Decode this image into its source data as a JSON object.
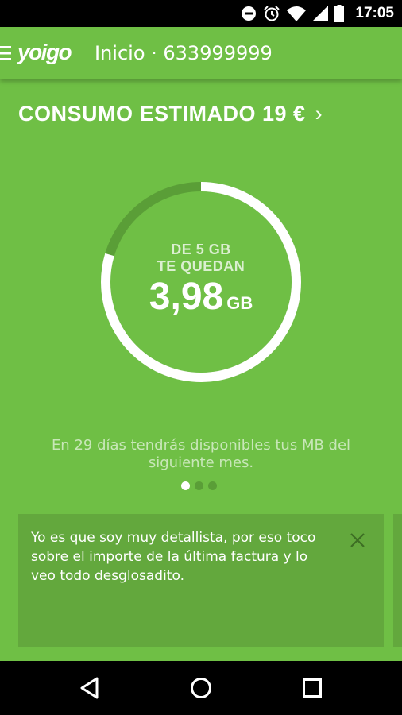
{
  "status_bar": {
    "time": "17:05",
    "icons": [
      "do-not-disturb-icon",
      "alarm-icon",
      "wifi-icon",
      "signal-icon",
      "battery-icon"
    ]
  },
  "header": {
    "menu_icon": "hamburger-menu-icon",
    "logo": "yoigo",
    "title": "Inicio · 633999999"
  },
  "consumption": {
    "label": "CONSUMO ESTIMADO 19 €",
    "chevron": "›"
  },
  "data_usage": {
    "total_line": "DE 5 GB",
    "remaining_label": "TE QUEDAN",
    "remaining_value": "3,98",
    "remaining_unit": "GB",
    "remaining_fraction": 0.796
  },
  "renewal_info": "En 29 días tendrás disponibles tus MB del siguiente mes.",
  "pager": {
    "count": 3,
    "active_index": 0
  },
  "tip_card": {
    "text": "Yo es que soy muy detallista, por eso toco sobre el importe de la última factura y lo veo todo desglosadito.",
    "close_icon": "close-icon"
  },
  "nav_bar": {
    "buttons": [
      "back-icon",
      "home-icon",
      "recents-icon"
    ]
  },
  "colors": {
    "primary_green": "#6fbf45",
    "card_green": "#63a83d",
    "ring_used": "#5a9e37",
    "ring_remaining": "#ffffff"
  }
}
